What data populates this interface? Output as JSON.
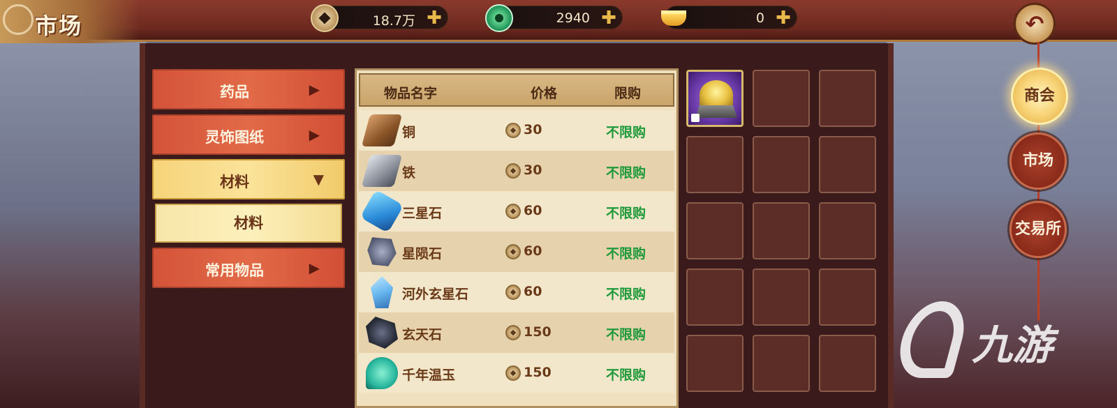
{
  "header": {
    "title": "市场",
    "back_icon": "back-arrow-icon",
    "currencies": [
      {
        "name": "copper-coin",
        "icon": "coin-icon",
        "value": "18.7万"
      },
      {
        "name": "jade",
        "icon": "jade-icon",
        "value": "2940"
      },
      {
        "name": "gold-ingot",
        "icon": "ingot-icon",
        "value": "0"
      }
    ]
  },
  "categories": [
    {
      "label": "药品",
      "state": "collapsed"
    },
    {
      "label": "灵饰图纸",
      "state": "collapsed"
    },
    {
      "label": "材料",
      "state": "expanded",
      "active": true
    },
    {
      "label": "常用物品",
      "state": "collapsed"
    }
  ],
  "subcategory": {
    "label": "材料"
  },
  "table": {
    "headers": {
      "name": "物品名字",
      "price": "价格",
      "limit": "限购"
    },
    "rows": [
      {
        "name": "铜",
        "icon": "copper-ingot-icon",
        "price": "30",
        "limit": "不限购"
      },
      {
        "name": "铁",
        "icon": "iron-ingot-icon",
        "price": "30",
        "limit": "不限购"
      },
      {
        "name": "三星石",
        "icon": "blue-crystal-icon",
        "price": "60",
        "limit": "不限购"
      },
      {
        "name": "星陨石",
        "icon": "meteorite-icon",
        "price": "60",
        "limit": "不限购"
      },
      {
        "name": "河外玄星石",
        "icon": "ice-crystal-icon",
        "price": "60",
        "limit": "不限购"
      },
      {
        "name": "玄天石",
        "icon": "dark-stone-icon",
        "price": "150",
        "limit": "不限购"
      },
      {
        "name": "千年温玉",
        "icon": "jade-swirl-icon",
        "price": "150",
        "limit": "不限购"
      }
    ]
  },
  "inventory": {
    "slots_filled": 1,
    "first_item_icon": "treasure-bowl-icon",
    "first_item_locked": true
  },
  "right_nav": [
    {
      "label": "商会",
      "active": true
    },
    {
      "label": "市场",
      "active": false
    },
    {
      "label": "交易所",
      "active": false
    }
  ],
  "watermark": {
    "text": "九游"
  },
  "colors": {
    "limit_text": "#1f9a3a",
    "active_tab": "#f6d47a",
    "inactive_tab": "#d4533a"
  }
}
